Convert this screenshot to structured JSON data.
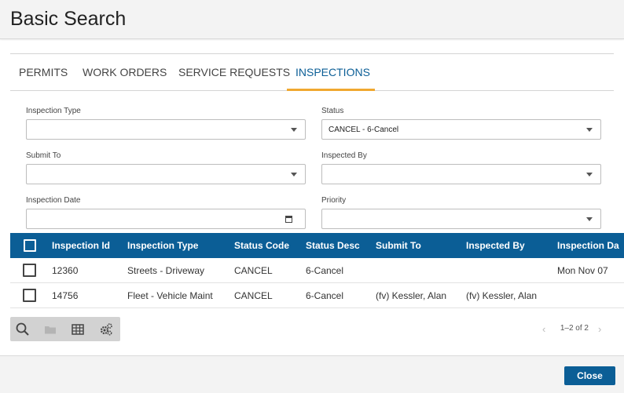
{
  "header": {
    "title": "Basic Search"
  },
  "tabs": [
    {
      "label": "PERMITS"
    },
    {
      "label": "WORK ORDERS"
    },
    {
      "label": "SERVICE REQUESTS"
    },
    {
      "label": "INSPECTIONS",
      "active": true
    }
  ],
  "form": {
    "inspection_type": {
      "label": "Inspection Type",
      "value": ""
    },
    "status": {
      "label": "Status",
      "value": "CANCEL - 6-Cancel"
    },
    "submit_to": {
      "label": "Submit To",
      "value": ""
    },
    "inspected_by": {
      "label": "Inspected By",
      "value": ""
    },
    "inspection_date": {
      "label": "Inspection Date",
      "value": ""
    },
    "priority": {
      "label": "Priority",
      "value": ""
    }
  },
  "table": {
    "columns": [
      "Inspection Id",
      "Inspection Type",
      "Status Code",
      "Status Desc",
      "Submit To",
      "Inspected By",
      "Inspection Da"
    ],
    "rows": [
      [
        "12360",
        "Streets - Driveway",
        "CANCEL",
        "6-Cancel",
        "",
        "",
        "Mon Nov 07"
      ],
      [
        "14756",
        "Fleet - Vehicle Maint",
        "CANCEL",
        "6-Cancel",
        "(fv) Kessler, Alan",
        "(fv) Kessler, Alan",
        ""
      ]
    ]
  },
  "toolbar": {
    "icons": [
      "search-icon",
      "folder-icon",
      "grid-icon",
      "settings-icon"
    ]
  },
  "pager": {
    "text": "1–2 of 2"
  },
  "footer": {
    "close_label": "Close"
  },
  "colors": {
    "primary": "#0b5e96",
    "tab_underline": "#f0a830"
  }
}
